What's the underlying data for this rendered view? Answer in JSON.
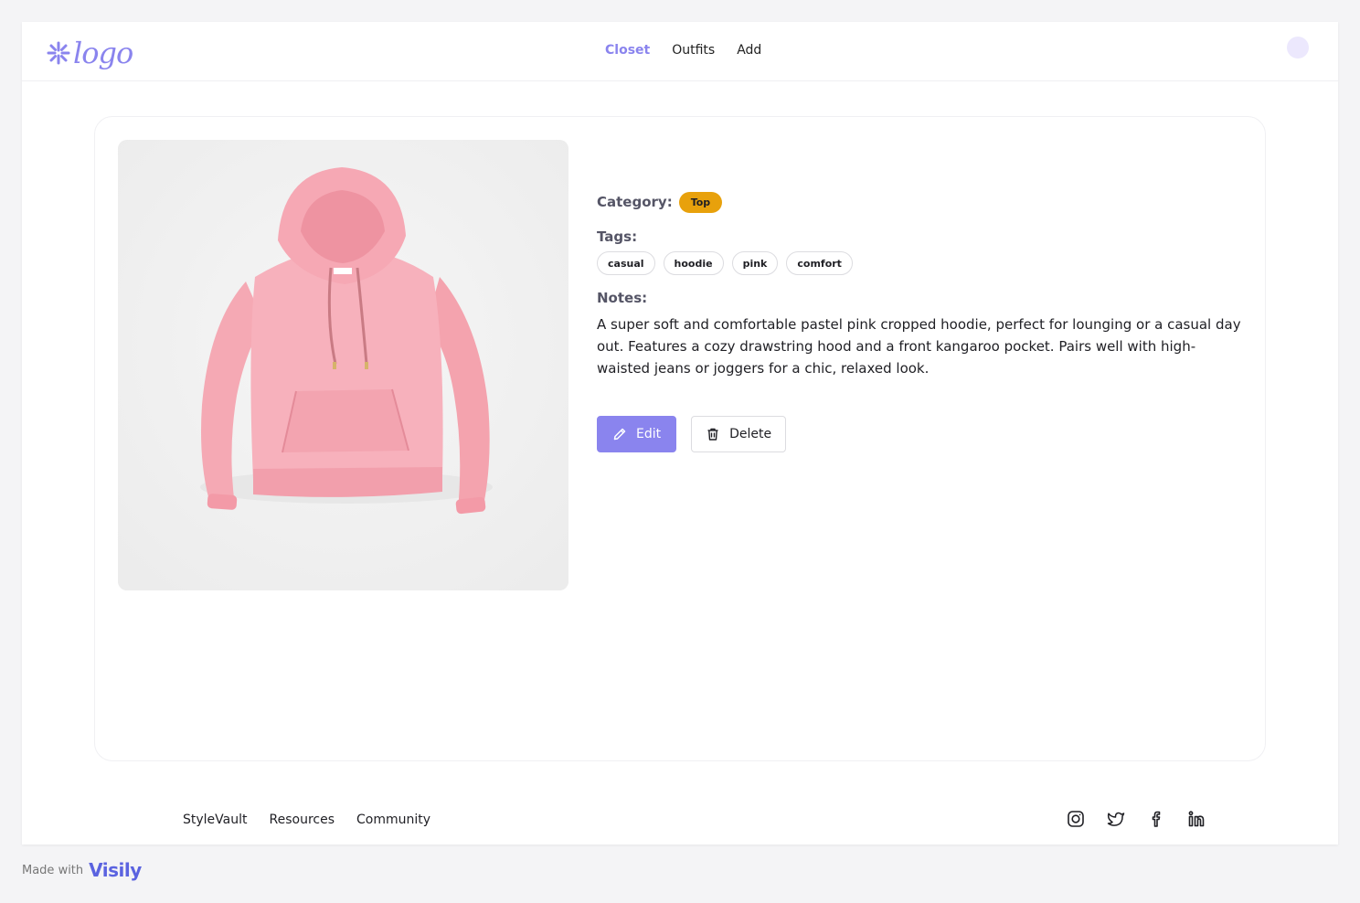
{
  "header": {
    "logo_text": "logo",
    "nav": [
      {
        "label": "Closet",
        "active": true
      },
      {
        "label": "Outfits",
        "active": false
      },
      {
        "label": "Add",
        "active": false
      }
    ]
  },
  "item": {
    "image_icon": "pink-hoodie-photo",
    "category_label": "Category:",
    "category_value": "Top",
    "tags_label": "Tags:",
    "tags": [
      "casual",
      "hoodie",
      "pink",
      "comfort"
    ],
    "notes_label": "Notes:",
    "notes": "A super soft and comfortable pastel pink cropped hoodie, perfect for lounging or a casual day out. Features a cozy drawstring hood and a front kangaroo pocket. Pairs well with high-waisted jeans or joggers for a chic, relaxed look.",
    "edit_label": "Edit",
    "delete_label": "Delete"
  },
  "footer": {
    "links": [
      "StyleVault",
      "Resources",
      "Community"
    ],
    "social": [
      "instagram-icon",
      "twitter-icon",
      "facebook-icon",
      "linkedin-icon"
    ]
  },
  "made_with": {
    "label": "Made with",
    "brand": "Visily"
  },
  "colors": {
    "accent": "#8a84ee",
    "category_badge": "#e8a10c",
    "avatar": "#ece8fd"
  }
}
